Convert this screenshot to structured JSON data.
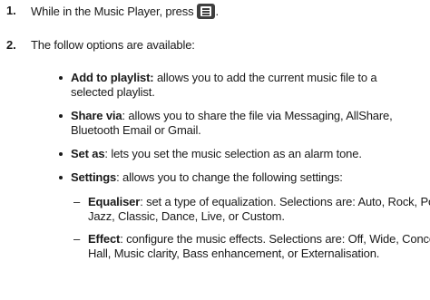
{
  "steps": [
    {
      "number": "1.",
      "text": "While in the Music Player, press",
      "icon": "menu-key-icon",
      "after_icon": "."
    },
    {
      "number": "2.",
      "text": "The follow options are available:"
    }
  ],
  "options": [
    {
      "term": "Add to playlist:",
      "line1": " allows you to add the current music file to a",
      "line2": "selected playlist."
    },
    {
      "term": "Share via",
      "line1": ": allows you to share the file via Messaging, AllShare,",
      "line2": "Bluetooth Email or Gmail."
    },
    {
      "term": "Set as",
      "line1": ": lets you set the music selection as an alarm tone."
    },
    {
      "term": "Settings",
      "line1": ": allows you to change the following settings:"
    }
  ],
  "settings": [
    {
      "dash": "–",
      "term": "Equaliser",
      "line1": ": set a type of equalization. Selections are: Auto, Rock, Pop,",
      "line2": "Jazz, Classic, Dance, Live, or Custom."
    },
    {
      "dash": "–",
      "term": "Effect",
      "line1": ": configure the music effects. Selections are: Off, Wide, Concert",
      "line2": "Hall, Music clarity, Bass enhancement, or Externalisation."
    }
  ]
}
